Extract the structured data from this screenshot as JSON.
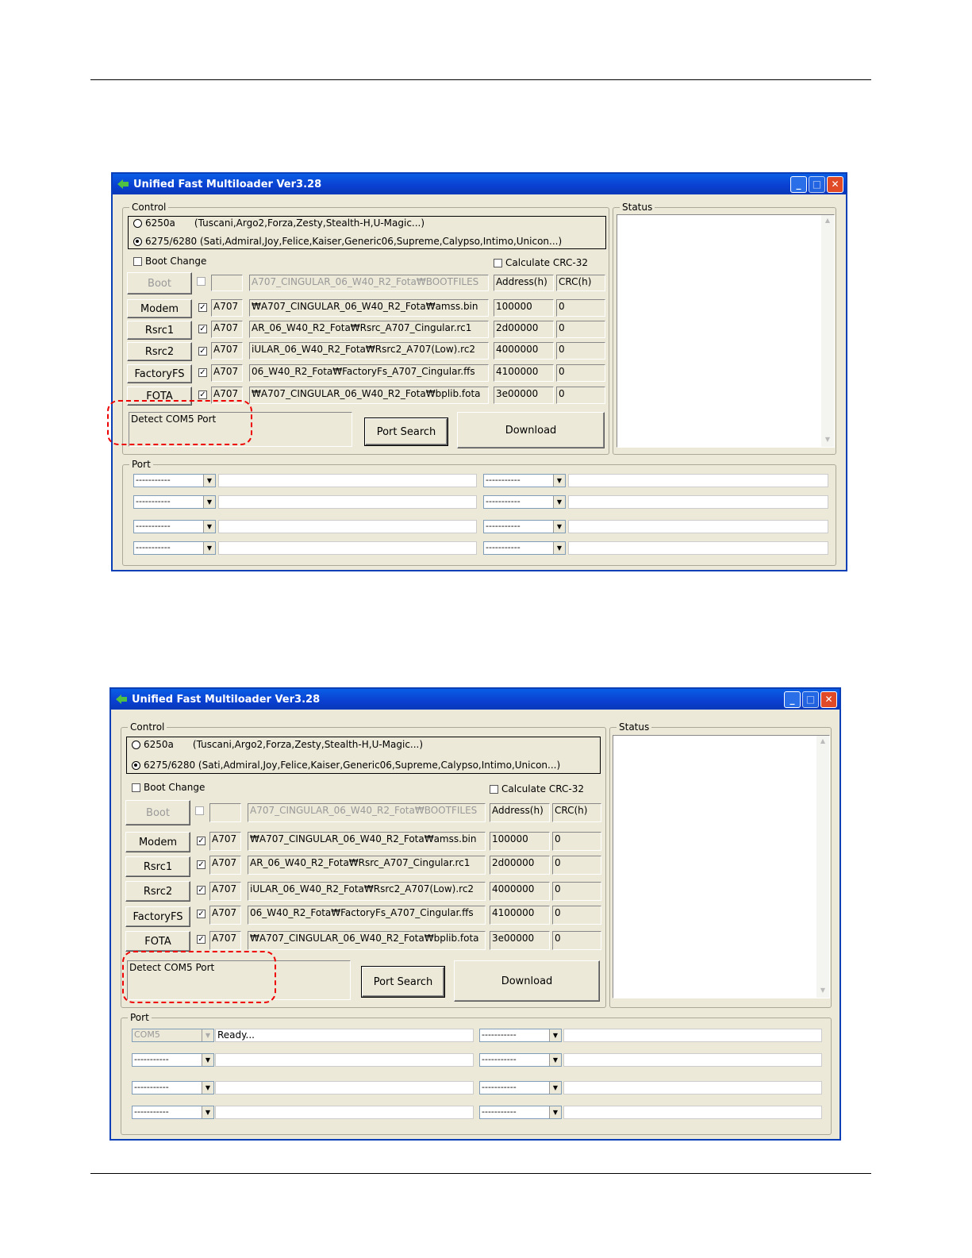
{
  "window": {
    "title": "Unified Fast Multiloader Ver3.28",
    "control_label": "Control",
    "status_label": "Status",
    "port_label": "Port",
    "radio_6250_id": "6250a",
    "radio_6250_desc": "(Tuscani,Argo2,Forza,Zesty,Stealth-H,U-Magic...)",
    "radio_6275": "6275/6280 (Sati,Admiral,Joy,Felice,Kaiser,Generic06,Supreme,Calypso,Intimo,Unicon...)",
    "boot_change": "Boot Change",
    "calc_crc": "Calculate CRC-32",
    "boot_button": "Boot",
    "boot_path": "A707_CINGULAR_06_W40_R2_Fota₩BOOTFILES",
    "address_header": "Address(h)",
    "crc_header": "CRC(h)",
    "rows": [
      {
        "button": "Modem",
        "model": "A707",
        "path": "₩A707_CINGULAR_06_W40_R2_Fota₩amss.bin",
        "address": "100000",
        "crc": "0"
      },
      {
        "button": "Rsrc1",
        "model": "A707",
        "path": "AR_06_W40_R2_Fota₩Rsrc_A707_Cingular.rc1",
        "address": "2d00000",
        "crc": "0"
      },
      {
        "button": "Rsrc2",
        "model": "A707",
        "path": "iULAR_06_W40_R2_Fota₩Rsrc2_A707(Low).rc2",
        "address": "4000000",
        "crc": "0"
      },
      {
        "button": "FactoryFS",
        "model": "A707",
        "path": "06_W40_R2_Fota₩FactoryFs_A707_Cingular.ffs",
        "address": "4100000",
        "crc": "0"
      },
      {
        "button": "FOTA",
        "model": "A707",
        "path": "₩A707_CINGULAR_06_W40_R2_Fota₩bplib.fota",
        "address": "3e00000",
        "crc": "0"
      }
    ],
    "detect_text": "Detect COM5 Port",
    "port_search": "Port Search",
    "download": "Download",
    "empty_port": "-----------",
    "com5": "COM5",
    "ready": "Ready..."
  },
  "colors": {
    "highlight": "#ee0000",
    "titlebar": "#0a4fd8"
  }
}
